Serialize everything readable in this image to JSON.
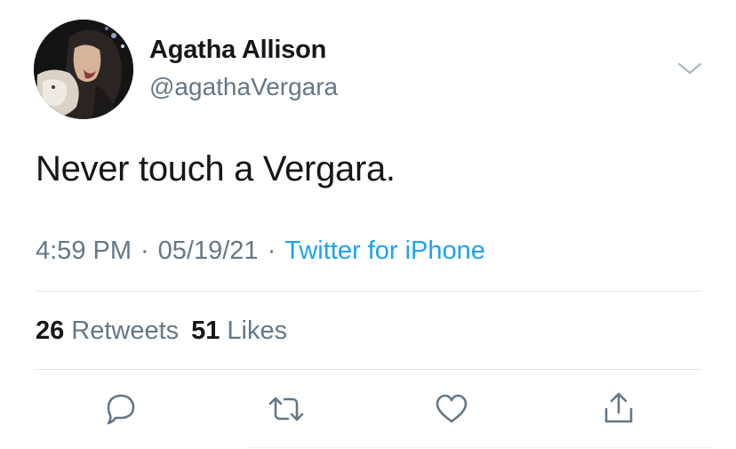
{
  "user": {
    "display_name": "Agatha Allison",
    "handle": "@agathaVergara"
  },
  "tweet": {
    "text": "Never touch a Vergara."
  },
  "meta": {
    "time": "4:59 PM",
    "separator": "·",
    "date": "05/19/21",
    "source": "Twitter for iPhone"
  },
  "stats": {
    "retweets_count": "26",
    "retweets_label": "Retweets",
    "likes_count": "51",
    "likes_label": "Likes"
  },
  "icons": {
    "reply": "speech-bubble-icon",
    "retweet": "retweet-arrows-icon",
    "like": "heart-icon",
    "share": "share-upload-icon",
    "menu": "chevron-down-icon"
  },
  "colors": {
    "text_primary": "#14171a",
    "text_secondary": "#657786",
    "link": "#1da1f2",
    "divider": "#e1e8ed"
  }
}
